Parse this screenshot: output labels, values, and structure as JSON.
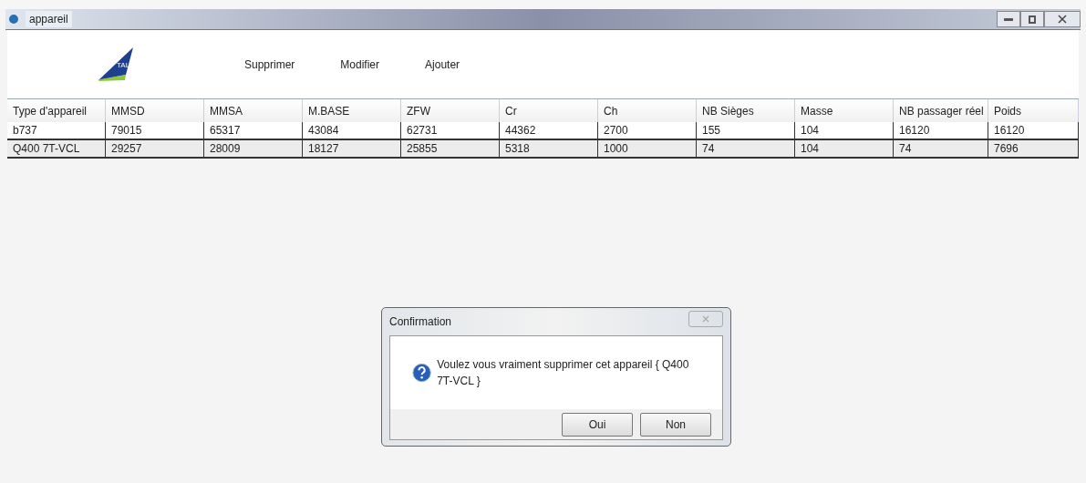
{
  "window": {
    "title": "appareil"
  },
  "logo": {
    "text": "TAL"
  },
  "toolbar": [
    "Supprimer",
    "Modifier",
    "Ajouter"
  ],
  "table": {
    "columns": [
      "Type d'appareil",
      "MMSD",
      "MMSA",
      "M.BASE",
      "ZFW",
      "Cr",
      "Ch",
      "NB Sièges",
      "Masse",
      "NB passager réel",
      "Poids"
    ],
    "rows": [
      {
        "selected": false,
        "cells": [
          "b737",
          "79015",
          "65317",
          "43084",
          "62731",
          "44362",
          "2700",
          "155",
          "104",
          "16120",
          "16120"
        ]
      },
      {
        "selected": true,
        "cells": [
          "Q400 7T-VCL",
          "29257",
          "28009",
          "18127",
          "25855",
          "5318",
          "1000",
          "74",
          "104",
          "74",
          "7696"
        ]
      }
    ]
  },
  "dialog": {
    "title": "Confirmation",
    "message": "Voulez vous vraiment supprimer cet appareil { Q400 7T-VCL }",
    "buttons": [
      "Oui",
      "Non"
    ]
  }
}
